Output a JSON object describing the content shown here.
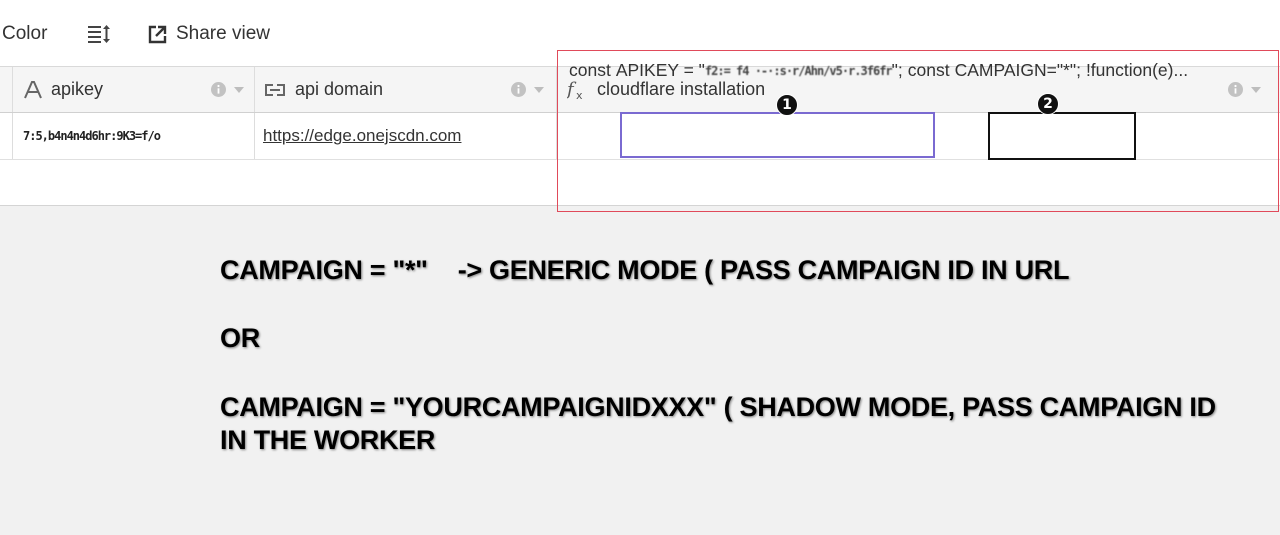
{
  "toolbar": {
    "color_label": "Color",
    "sort_icon": "row-height-icon",
    "share_icon": "share-external-icon",
    "share_label": "Share view"
  },
  "columns": [
    {
      "label": "apikey",
      "icon": "text-field-icon"
    },
    {
      "label": "api domain",
      "icon": "link-field-icon"
    },
    {
      "label": "cloudflare installation",
      "icon": "formula-icon"
    }
  ],
  "row": {
    "apikey": "7:5,b4n4n4d6hr:9K3=f/o",
    "api_domain": "https://edge.onejscdn.com",
    "code": {
      "p1": "const",
      "p2": "APIKEY = \"",
      "p3": "f2:= f4 ·-·:s·r/Ahn/v5·r.3f6fr",
      "p4": "\";",
      "p5": "const",
      "p6": "CAMPAIGN=\"*\";",
      "p7": "!function(e)..."
    }
  },
  "badges": {
    "one": "1",
    "two": "2"
  },
  "annotation": {
    "line1_a": "CAMPAIGN = \"*\"",
    "line1_b": "-> GENERIC MODE ( PASS CAMPAIGN ID IN URL",
    "line2": "OR",
    "line3": "CAMPAIGN = \"YOURCAMPAIGNIDXXX\" ( SHADOW MODE, PASS CAMPAIGN ID IN THE WORKER"
  },
  "colors": {
    "highlight_purple": "#7a6ad1",
    "highlight_black": "#111111",
    "highlight_red": "#e04a5a"
  }
}
